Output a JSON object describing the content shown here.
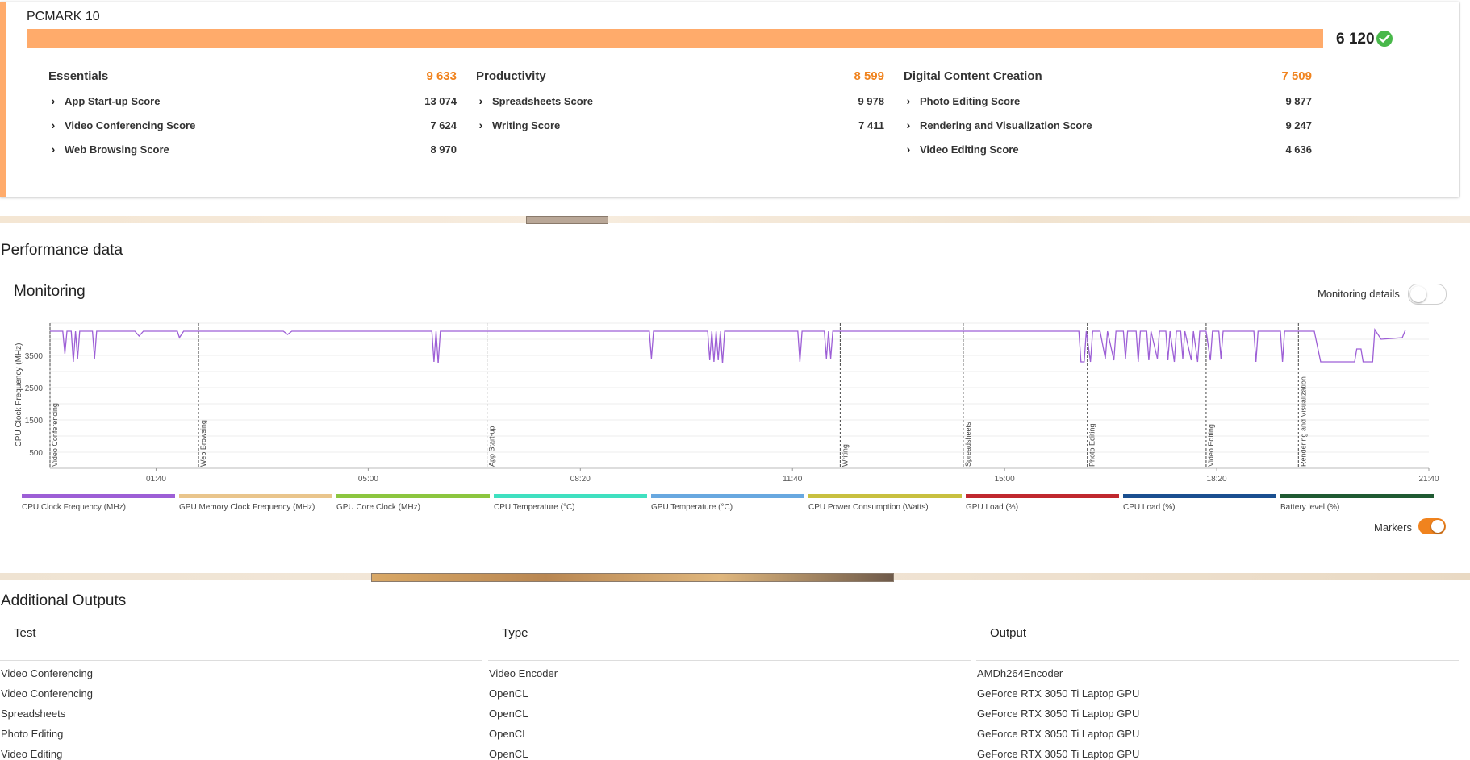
{
  "benchmark": {
    "title": "PCMARK 10",
    "total_score": "6 120",
    "score_fraction": 1.0,
    "accent_color": "#ffab6b",
    "groups": [
      {
        "name": "Essentials",
        "score": "9 633",
        "items": [
          {
            "label": "App Start-up Score",
            "value": "13 074"
          },
          {
            "label": "Video Conferencing Score",
            "value": "7 624"
          },
          {
            "label": "Web Browsing Score",
            "value": "8 970"
          }
        ]
      },
      {
        "name": "Productivity",
        "score": "8 599",
        "items": [
          {
            "label": "Spreadsheets Score",
            "value": "9 978"
          },
          {
            "label": "Writing Score",
            "value": "7 411"
          }
        ]
      },
      {
        "name": "Digital Content Creation",
        "score": "7 509",
        "items": [
          {
            "label": "Photo Editing Score",
            "value": "9 877"
          },
          {
            "label": "Rendering and Visualization Score",
            "value": "9 247"
          },
          {
            "label": "Video Editing Score",
            "value": "4 636"
          }
        ]
      }
    ]
  },
  "performance": {
    "title": "Performance data",
    "monitoring_title": "Monitoring",
    "monitoring_details_label": "Monitoring details",
    "monitoring_details_on": false,
    "markers_label": "Markers",
    "markers_on": true
  },
  "chart_data": {
    "type": "line",
    "ylabel": "CPU Clock Frequency (MHz)",
    "y_ticks": [
      "3500",
      "2500",
      "1500",
      "500"
    ],
    "y_tick_values": [
      3500,
      2500,
      1500,
      500
    ],
    "ylim": [
      0,
      4500
    ],
    "x_ticks": [
      "01:40",
      "05:00",
      "08:20",
      "11:40",
      "15:00",
      "18:20",
      "21:40"
    ],
    "x_tick_seconds": [
      100,
      300,
      500,
      700,
      900,
      1100,
      1300
    ],
    "xlim_seconds": [
      0,
      1300
    ],
    "grid": true,
    "markers": [
      {
        "label": "Video Conferencing",
        "t": 0
      },
      {
        "label": "Web Browsing",
        "t": 140
      },
      {
        "label": "App Start-up",
        "t": 412
      },
      {
        "label": "Writing",
        "t": 745
      },
      {
        "label": "Spreadsheets",
        "t": 861
      },
      {
        "label": "Photo Editing",
        "t": 978
      },
      {
        "label": "Video Editing",
        "t": 1090
      },
      {
        "label": "Rendering and Visualization",
        "t": 1177
      }
    ],
    "series": [
      {
        "name": "CPU Clock Frequency (MHz)",
        "color": "#9d5fd6",
        "points": [
          [
            0,
            4250
          ],
          [
            12,
            4250
          ],
          [
            14,
            3550
          ],
          [
            16,
            4250
          ],
          [
            20,
            4250
          ],
          [
            22,
            3300
          ],
          [
            24,
            4250
          ],
          [
            26,
            3400
          ],
          [
            28,
            4250
          ],
          [
            40,
            4250
          ],
          [
            42,
            3400
          ],
          [
            44,
            4250
          ],
          [
            80,
            4250
          ],
          [
            84,
            4100
          ],
          [
            88,
            4250
          ],
          [
            120,
            4250
          ],
          [
            122,
            4050
          ],
          [
            126,
            4250
          ],
          [
            140,
            4250
          ],
          [
            220,
            4250
          ],
          [
            224,
            4150
          ],
          [
            228,
            4250
          ],
          [
            360,
            4250
          ],
          [
            362,
            3300
          ],
          [
            364,
            4250
          ],
          [
            366,
            3250
          ],
          [
            368,
            4250
          ],
          [
            412,
            4250
          ],
          [
            565,
            4250
          ],
          [
            567,
            3400
          ],
          [
            569,
            4250
          ],
          [
            620,
            4250
          ],
          [
            622,
            3350
          ],
          [
            624,
            4250
          ],
          [
            626,
            3300
          ],
          [
            628,
            4250
          ],
          [
            630,
            3350
          ],
          [
            632,
            4250
          ],
          [
            634,
            3250
          ],
          [
            636,
            4250
          ],
          [
            705,
            4250
          ],
          [
            707,
            3300
          ],
          [
            709,
            4250
          ],
          [
            730,
            4250
          ],
          [
            732,
            3400
          ],
          [
            734,
            4250
          ],
          [
            736,
            3400
          ],
          [
            738,
            4250
          ],
          [
            745,
            4250
          ],
          [
            970,
            4250
          ],
          [
            972,
            3300
          ],
          [
            975,
            3300
          ],
          [
            977,
            4250
          ],
          [
            981,
            3300
          ],
          [
            983,
            4250
          ],
          [
            990,
            4250
          ],
          [
            995,
            3400
          ],
          [
            997,
            4250
          ],
          [
            1003,
            3350
          ],
          [
            1005,
            4250
          ],
          [
            1012,
            4250
          ],
          [
            1014,
            3400
          ],
          [
            1016,
            4250
          ],
          [
            1024,
            4250
          ],
          [
            1026,
            3300
          ],
          [
            1028,
            4250
          ],
          [
            1034,
            4250
          ],
          [
            1036,
            3350
          ],
          [
            1038,
            4250
          ],
          [
            1044,
            3400
          ],
          [
            1046,
            4250
          ],
          [
            1052,
            4250
          ],
          [
            1054,
            3350
          ],
          [
            1056,
            4250
          ],
          [
            1060,
            3300
          ],
          [
            1062,
            4250
          ],
          [
            1066,
            4250
          ],
          [
            1068,
            3400
          ],
          [
            1070,
            4250
          ],
          [
            1076,
            3350
          ],
          [
            1078,
            4250
          ],
          [
            1082,
            3300
          ],
          [
            1084,
            4250
          ],
          [
            1090,
            4250
          ],
          [
            1094,
            3350
          ],
          [
            1096,
            4250
          ],
          [
            1102,
            4250
          ],
          [
            1104,
            3400
          ],
          [
            1106,
            4250
          ],
          [
            1135,
            4250
          ],
          [
            1137,
            3300
          ],
          [
            1139,
            4250
          ],
          [
            1160,
            4250
          ],
          [
            1162,
            3300
          ],
          [
            1164,
            4250
          ],
          [
            1177,
            4250
          ],
          [
            1192,
            4250
          ],
          [
            1198,
            3300
          ],
          [
            1230,
            3300
          ],
          [
            1232,
            3700
          ],
          [
            1236,
            3700
          ],
          [
            1238,
            3300
          ],
          [
            1247,
            3300
          ],
          [
            1249,
            4300
          ],
          [
            1255,
            4000
          ],
          [
            1275,
            4050
          ],
          [
            1278,
            4300
          ]
        ]
      }
    ]
  },
  "legend": [
    {
      "label": "CPU Clock Frequency (MHz)",
      "color": "#9d5fd6"
    },
    {
      "label": "GPU Memory Clock Frequency (MHz)",
      "color": "#e9c58c"
    },
    {
      "label": "GPU Core Clock (MHz)",
      "color": "#8cc63f"
    },
    {
      "label": "CPU Temperature (°C)",
      "color": "#3fe0c0"
    },
    {
      "label": "GPU Temperature (°C)",
      "color": "#68a8e0"
    },
    {
      "label": "CPU Power Consumption (Watts)",
      "color": "#c8c040"
    },
    {
      "label": "GPU Load (%)",
      "color": "#c0282e"
    },
    {
      "label": "CPU Load (%)",
      "color": "#1a4f90"
    },
    {
      "label": "Battery level (%)",
      "color": "#1f5a32"
    }
  ],
  "additional": {
    "title": "Additional Outputs",
    "headers": [
      "Test",
      "Type",
      "Output"
    ],
    "rows": [
      [
        "Video Conferencing",
        "Video Encoder",
        "AMDh264Encoder"
      ],
      [
        "Video Conferencing",
        "OpenCL",
        "GeForce RTX 3050 Ti Laptop GPU"
      ],
      [
        "Spreadsheets",
        "OpenCL",
        "GeForce RTX 3050 Ti Laptop GPU"
      ],
      [
        "Photo Editing",
        "OpenCL",
        "GeForce RTX 3050 Ti Laptop GPU"
      ],
      [
        "Video Editing",
        "OpenCL",
        "GeForce RTX 3050 Ti Laptop GPU"
      ]
    ]
  }
}
